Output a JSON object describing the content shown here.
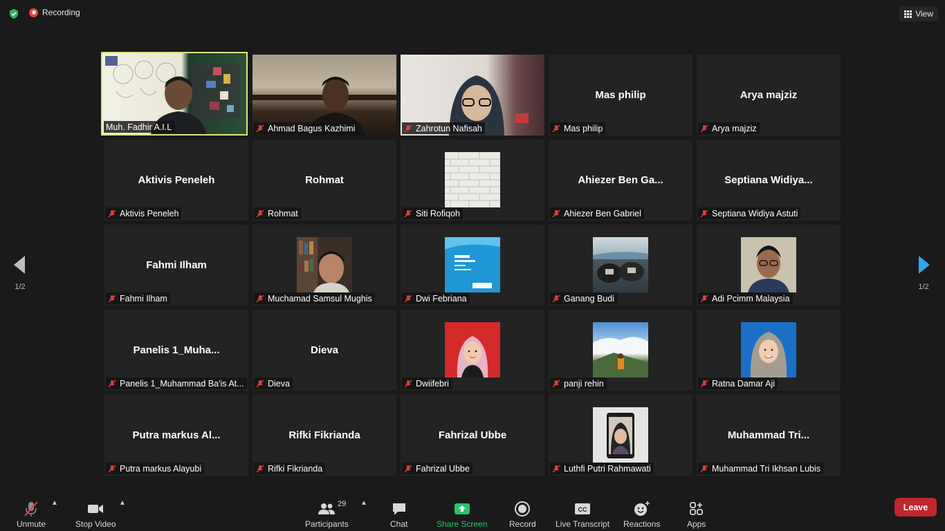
{
  "topbar": {
    "recording_label": "Recording",
    "view_label": "View"
  },
  "pager": {
    "left_label": "1/2",
    "right_label": "1/2"
  },
  "participants": [
    {
      "big": "",
      "label": "Muh. Fadhir  A.I.L",
      "muted": false,
      "active": true
    },
    {
      "big": "",
      "label": "Ahmad Bagus Kazhimi",
      "muted": true
    },
    {
      "big": "",
      "label": "Zahrotun Nafisah",
      "muted": true
    },
    {
      "big": "Mas philip",
      "label": "Mas philip",
      "muted": true
    },
    {
      "big": "Arya majziz",
      "label": "Arya majziz",
      "muted": true
    },
    {
      "big": "Aktivis Peneleh",
      "label": "Aktivis Peneleh",
      "muted": true
    },
    {
      "big": "Rohmat",
      "label": "Rohmat",
      "muted": true
    },
    {
      "big": "",
      "label": "Siti Rofiqoh",
      "muted": true
    },
    {
      "big": "Ahiezer  Ben  Ga...",
      "label": "Ahiezer Ben Gabriel",
      "muted": true
    },
    {
      "big": "Septiana  Widiya...",
      "label": "Septiana Widiya Astuti",
      "muted": true
    },
    {
      "big": "Fahmi Ilham",
      "label": "Fahmi Ilham",
      "muted": true
    },
    {
      "big": "",
      "label": "Muchamad Samsul Mughis",
      "muted": true
    },
    {
      "big": "",
      "label": "Dwi Febriana",
      "muted": true
    },
    {
      "big": "",
      "label": "Ganang Budi",
      "muted": true
    },
    {
      "big": "",
      "label": "Adi Pcimm Malaysia",
      "muted": true
    },
    {
      "big": "Panelis  1_Muha...",
      "label": "Panelis 1_Muhammad Ba'is At...",
      "muted": true
    },
    {
      "big": "Dieva",
      "label": "Dieva",
      "muted": true
    },
    {
      "big": "",
      "label": "Dwiifebri",
      "muted": true
    },
    {
      "big": "",
      "label": "panji rehin",
      "muted": true
    },
    {
      "big": "",
      "label": "Ratna Damar Aji",
      "muted": true
    },
    {
      "big": "Putra  markus  Al...",
      "label": "Putra markus Alayubi",
      "muted": true
    },
    {
      "big": "Rifki Fikrianda",
      "label": "Rifki Fikrianda",
      "muted": true
    },
    {
      "big": "Fahrizal Ubbe",
      "label": "Fahrizal Ubbe",
      "muted": true
    },
    {
      "big": "",
      "label": "Luthfi Putri Rahmawati",
      "muted": true
    },
    {
      "big": "Muhammad  Tri...",
      "label": "Muhammad Tri Ikhsan Lubis",
      "muted": true
    }
  ],
  "toolbar": {
    "unmute": "Unmute",
    "stop_video": "Stop Video",
    "participants": "Participants",
    "participants_count": "29",
    "chat": "Chat",
    "share_screen": "Share Screen",
    "record": "Record",
    "live_transcript": "Live Transcript",
    "reactions": "Reactions",
    "apps": "Apps",
    "leave": "Leave"
  },
  "colors": {
    "active_speaker": "#dbe87b",
    "share_green": "#27c46a",
    "leave_red": "#c1272d",
    "muted_red": "#e0413a"
  }
}
